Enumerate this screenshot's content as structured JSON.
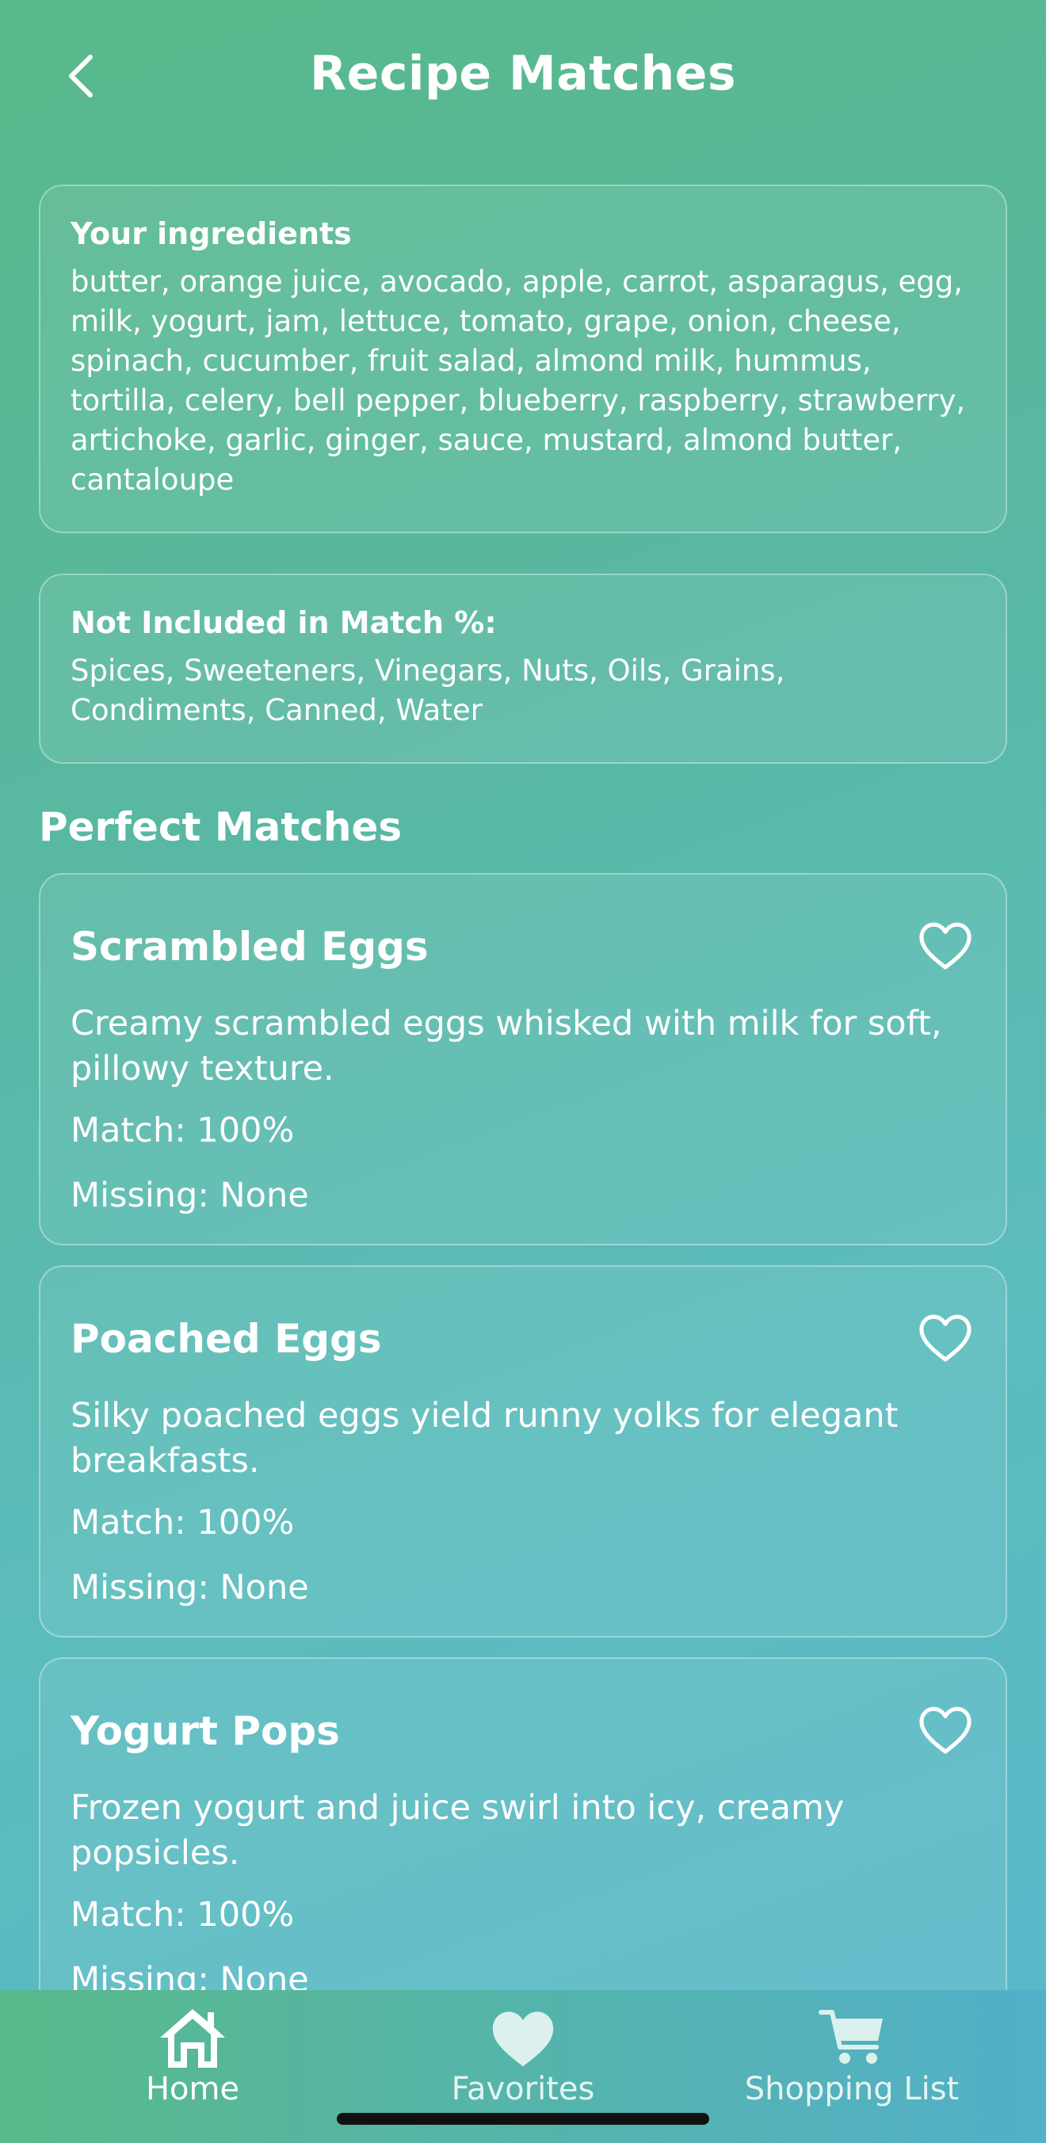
{
  "header": {
    "title": "Recipe Matches",
    "back_icon": "chevron-left-icon"
  },
  "ingredients_card": {
    "label": "Your ingredients",
    "text": "butter, orange juice, avocado, apple, carrot, asparagus, egg, milk, yogurt, jam, lettuce, tomato, grape, onion, cheese, spinach, cucumber, fruit salad, almond milk, hummus, tortilla, celery, bell pepper, blueberry, raspberry, strawberry, artichoke, garlic, ginger, sauce, mustard, almond butter, cantaloupe"
  },
  "excluded_card": {
    "label": "Not Included in Match %:",
    "text": "Spices, Sweeteners, Vinegars, Nuts, Oils, Grains, Condiments, Canned, Water"
  },
  "section_title": "Perfect Matches",
  "recipes": [
    {
      "title": "Scrambled Eggs",
      "description": "Creamy scrambled eggs whisked with milk for soft, pillowy texture.",
      "match": "Match: 100%",
      "missing": "Missing: None"
    },
    {
      "title": "Poached Eggs",
      "description": "Silky poached eggs yield runny yolks for elegant breakfasts.",
      "match": "Match: 100%",
      "missing": "Missing: None"
    },
    {
      "title": "Yogurt Pops",
      "description": "Frozen yogurt and juice swirl into icy, creamy popsicles.",
      "match": "Match: 100%",
      "missing": "Missing: None"
    }
  ],
  "tabbar": {
    "home": {
      "label": "Home",
      "icon": "house-icon"
    },
    "favorites": {
      "label": "Favorites",
      "icon": "heart-icon"
    },
    "shopping": {
      "label": "Shopping List",
      "icon": "cart-icon"
    }
  }
}
